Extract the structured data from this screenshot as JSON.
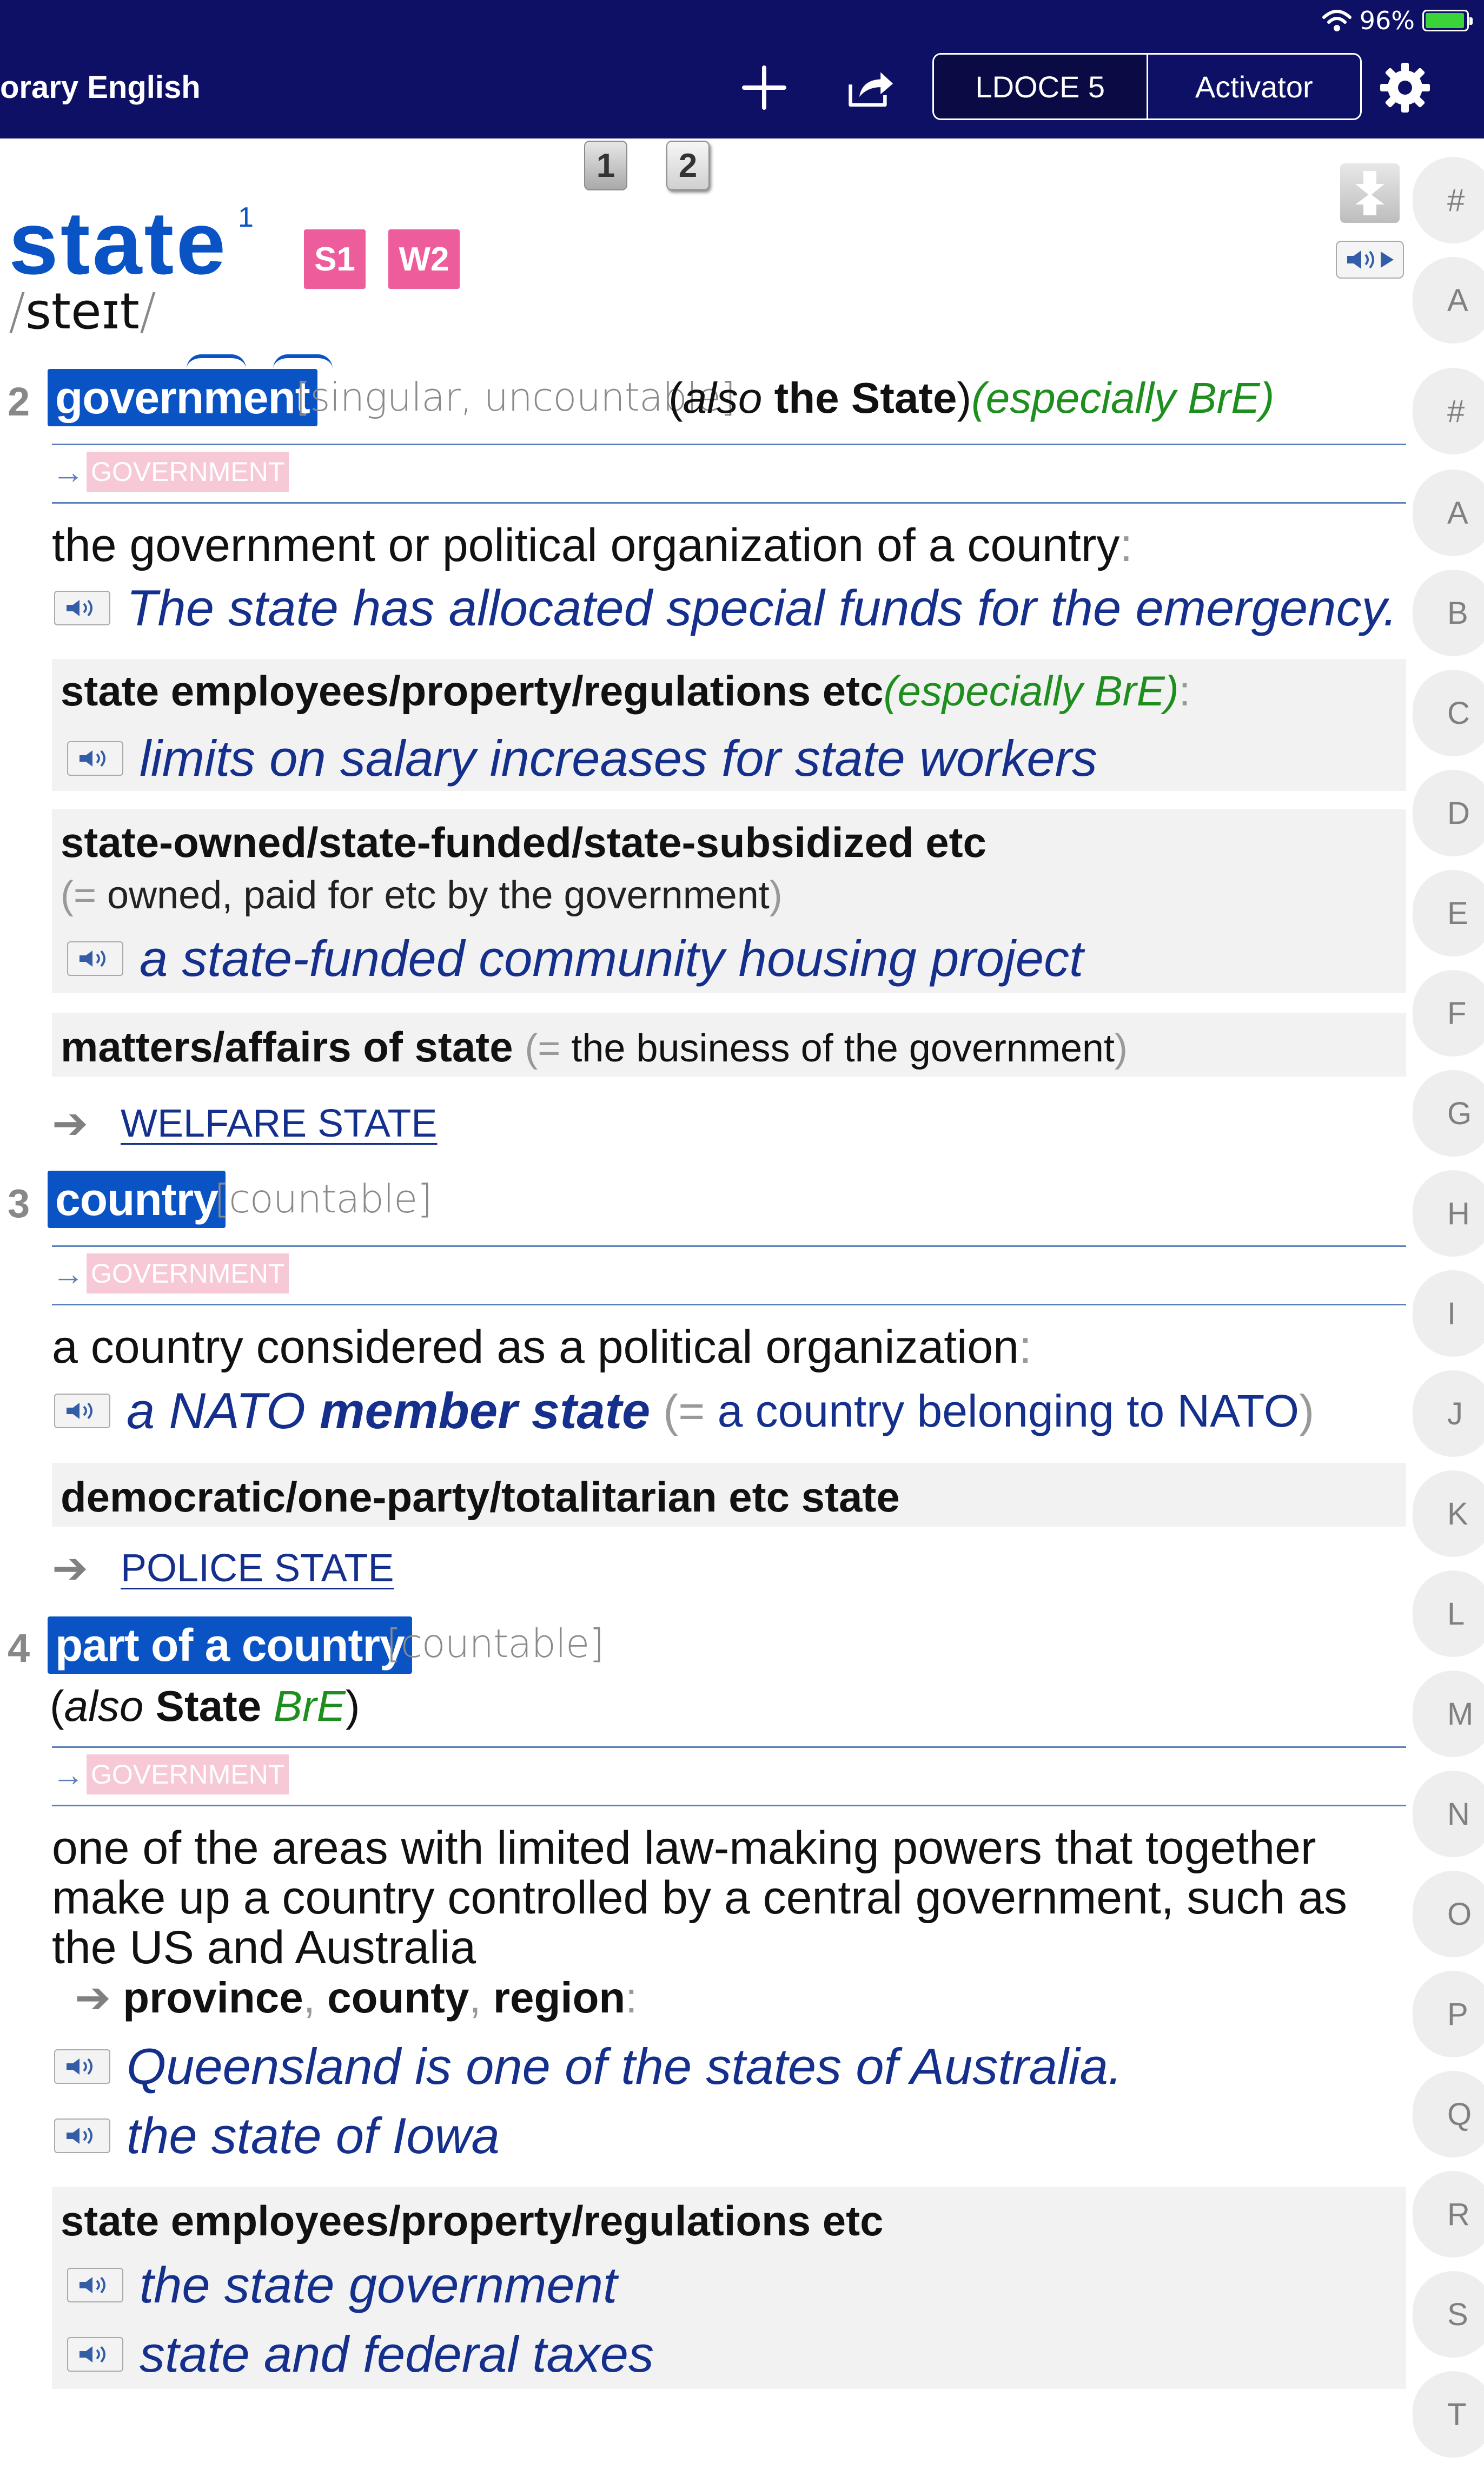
{
  "status": {
    "battery": "96%",
    "battery_level": 0.96
  },
  "topbar": {
    "title": "orary English",
    "segments": [
      "LDOCE 5",
      "Activator"
    ]
  },
  "pages": [
    "1",
    "2"
  ],
  "entry": {
    "headword": "state",
    "homograph": "1",
    "badges": [
      "S1",
      "W2"
    ],
    "pronunciation": "steɪt"
  },
  "senses": [
    {
      "num": "2",
      "signpost": "government",
      "grammar": "[singular, uncountable]",
      "also_open": "(",
      "also_word": "also",
      "also_text": "the State",
      "also_close": ")",
      "region": "(especially BrE)",
      "register": "GOVERNMENT",
      "definition": "the government or political organization of a country",
      "def_colon": ":",
      "example": "The state has allocated special funds for the emergency.",
      "boxes": [
        {
          "head": "state employees/property/regulations etc",
          "region": "(especially BrE)",
          "colon": ":",
          "example": "limits on salary increases for state workers"
        },
        {
          "head": "state-owned/state-funded/state-subsidized etc",
          "sub": "owned, paid for etc by the government",
          "example": "a state-funded community housing project"
        },
        {
          "head": "matters/affairs of state",
          "sub": "the business of the government"
        }
      ],
      "xref": "WELFARE STATE"
    },
    {
      "num": "3",
      "signpost": "country",
      "grammar": "[countable]",
      "register": "GOVERNMENT",
      "definition": "a country considered as a political organization",
      "def_colon": ":",
      "example_a": "a NATO",
      "example_b": "member state",
      "example_gloss": "a country belonging to NATO",
      "box_head": "democratic/one-party/totalitarian etc state",
      "xref": "POLICE STATE"
    },
    {
      "num": "4",
      "signpost": "part of a country",
      "grammar": "[countable]",
      "also_word": "also",
      "also_text": "State",
      "region": "BrE",
      "register": "GOVERNMENT",
      "definition_lines": [
        "one of the areas with limited law-making powers that together",
        "make up a country controlled by a central government, such as",
        "the US and Australia"
      ],
      "related": [
        "province",
        "county",
        "region"
      ],
      "examples": [
        "Queensland is one of the states of Australia.",
        "the state of Iowa"
      ],
      "box_head": "state employees/property/regulations etc",
      "box_examples": [
        "the state government",
        "state and federal taxes"
      ]
    }
  ],
  "alphabet": [
    "#",
    "A",
    "#",
    "A",
    "B",
    "C",
    "D",
    "E",
    "F",
    "G",
    "H",
    "I",
    "J",
    "K",
    "L",
    "M",
    "N",
    "O",
    "P",
    "Q",
    "R",
    "S",
    "T"
  ]
}
